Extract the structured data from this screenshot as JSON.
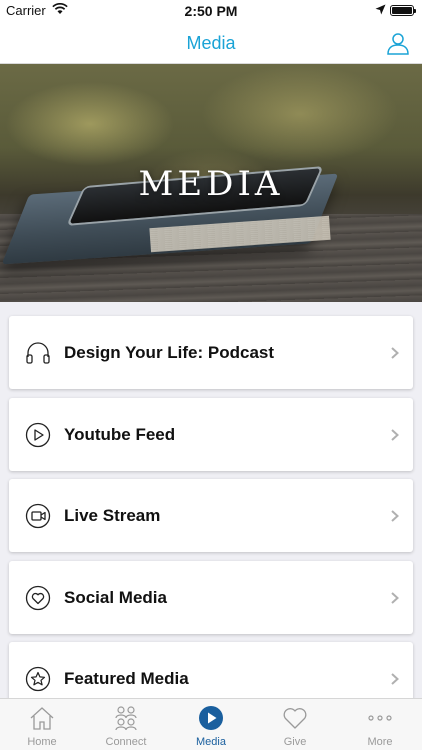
{
  "status_bar": {
    "carrier": "Carrier",
    "time": "2:50 PM"
  },
  "nav": {
    "title": "Media",
    "profile_icon": "person-icon"
  },
  "hero": {
    "title": "MEDIA"
  },
  "menu": {
    "items": [
      {
        "label": "Design Your Life: Podcast",
        "icon": "headphones-icon"
      },
      {
        "label": "Youtube Feed",
        "icon": "play-circle-icon"
      },
      {
        "label": "Live Stream",
        "icon": "video-camera-icon"
      },
      {
        "label": "Social Media",
        "icon": "heart-circle-icon"
      },
      {
        "label": "Featured Media",
        "icon": "star-circle-icon"
      }
    ]
  },
  "tab_bar": {
    "tabs": [
      {
        "label": "Home",
        "icon": "home-icon",
        "active": false
      },
      {
        "label": "Connect",
        "icon": "people-icon",
        "active": false
      },
      {
        "label": "Media",
        "icon": "play-icon",
        "active": true
      },
      {
        "label": "Give",
        "icon": "heart-icon",
        "active": false
      },
      {
        "label": "More",
        "icon": "more-icon",
        "active": false
      }
    ]
  },
  "colors": {
    "accent": "#1aa3d6",
    "tab_active": "#1a5f9e",
    "tab_inactive": "#9a9a9a",
    "background": "#efeff4"
  }
}
